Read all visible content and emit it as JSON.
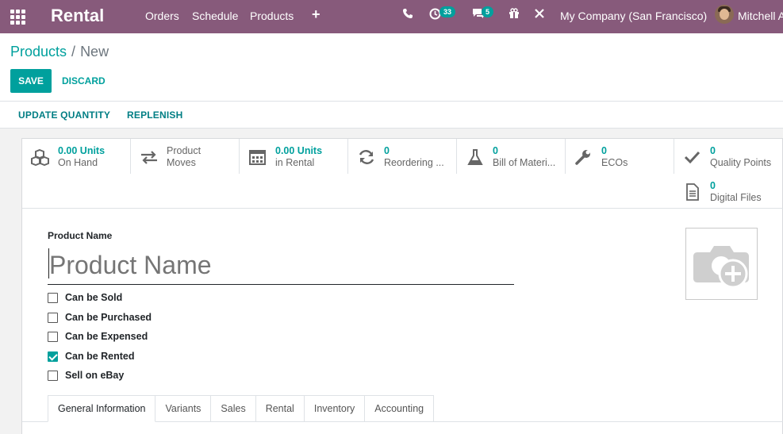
{
  "navbar": {
    "app_title": "Rental",
    "menu": [
      "Orders",
      "Schedule",
      "Products"
    ],
    "activity_badge": "33",
    "messages_badge": "5",
    "company": "My Company (San Francisco)",
    "user": "Mitchell A"
  },
  "control_panel": {
    "breadcrumb_parent": "Products",
    "breadcrumb_current": "New",
    "save_label": "SAVE",
    "discard_label": "DISCARD"
  },
  "actions": {
    "update_quantity": "UPDATE QUANTITY",
    "replenish": "REPLENISH"
  },
  "stat_buttons": [
    {
      "value": "0.00 Units",
      "label": "On Hand",
      "icon": "cubes-icon"
    },
    {
      "value": "Product",
      "label": "Moves",
      "icon": "exchange-icon"
    },
    {
      "value": "0.00 Units",
      "label": "in Rental",
      "icon": "calendar-icon"
    },
    {
      "value": "0",
      "label": "Reordering ...",
      "icon": "refresh-icon"
    },
    {
      "value": "0",
      "label": "Bill of Materi...",
      "icon": "flask-icon"
    },
    {
      "value": "0",
      "label": "ECOs",
      "icon": "wrench-icon"
    },
    {
      "value": "0",
      "label": "Quality Points",
      "icon": "check-icon"
    },
    {
      "value": "0",
      "label": "Digital Files",
      "icon": "file-icon"
    }
  ],
  "form": {
    "name_label": "Product Name",
    "name_placeholder": "Product Name",
    "checkboxes": [
      {
        "label": "Can be Sold",
        "checked": false
      },
      {
        "label": "Can be Purchased",
        "checked": false
      },
      {
        "label": "Can be Expensed",
        "checked": false
      },
      {
        "label": "Can be Rented",
        "checked": true
      },
      {
        "label": "Sell on eBay",
        "checked": false
      }
    ]
  },
  "tabs": [
    "General Information",
    "Variants",
    "Sales",
    "Rental",
    "Inventory",
    "Accounting"
  ],
  "colors": {
    "navbar": "#875a7b",
    "accent": "#00a09d"
  }
}
